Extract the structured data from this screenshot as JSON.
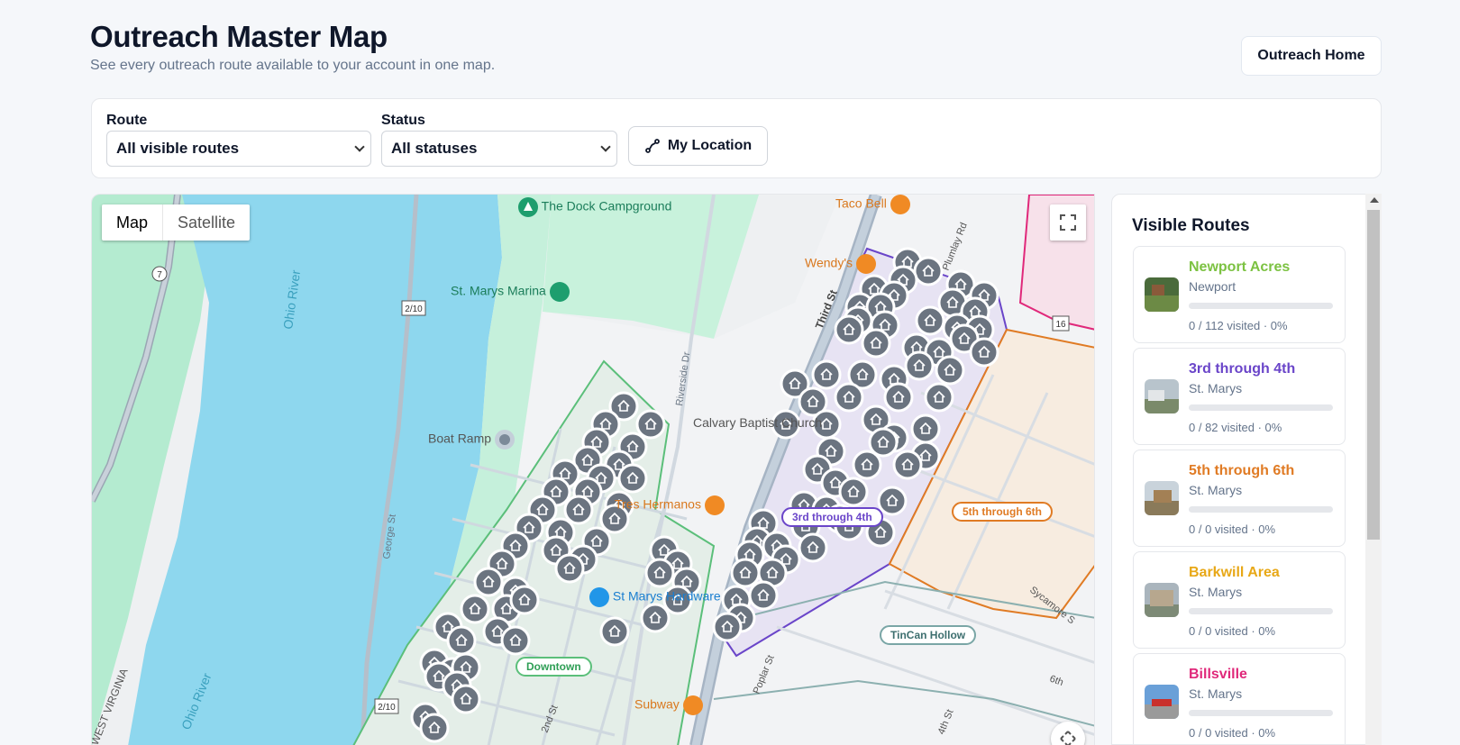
{
  "header": {
    "title": "Outreach Master Map",
    "subtitle": "See every outreach route available to your account in one map.",
    "home_button": "Outreach Home"
  },
  "filters": {
    "route_label": "Route",
    "route_value": "All visible routes",
    "status_label": "Status",
    "status_value": "All statuses",
    "location_button": "My Location"
  },
  "map": {
    "type_controls": [
      "Map",
      "Satellite"
    ],
    "selected_type": "Map",
    "pois": {
      "campground": "The Dock Campground",
      "marina": "St. Marys Marina",
      "boat_ramp": "Boat Ramp",
      "taco_bell": "Taco Bell",
      "wendys": "Wendy's",
      "church": "Calvary Baptist Church",
      "hermanos": "Tres Hermanos",
      "hardware": "St Marys Hardware",
      "subway": "Subway"
    },
    "road_labels": {
      "ohio_river_1": "Ohio River",
      "ohio_river_2": "Ohio River",
      "west_virginia": "WEST VIRGINIA",
      "riverside": "Riverside Dr",
      "george": "George St",
      "third": "Third St",
      "pumlay": "Plumlay Rd",
      "poplar": "Poplar St",
      "second": "2nd St",
      "fourth": "4th St",
      "sixth": "6th",
      "sycamore": "Sycamore S",
      "rt7": "7",
      "rt210a": "2/10",
      "rt210b": "2/10",
      "rt16": "16"
    },
    "route_labels": {
      "third_fourth": "3rd through 4th",
      "fifth_sixth": "5th through 6th",
      "tincan": "TinCan Hollow",
      "downtown": "Downtown"
    }
  },
  "sidebar": {
    "title": "Visible Routes",
    "routes": [
      {
        "name": "Newport Acres",
        "area": "Newport",
        "visited": 0,
        "total": 112,
        "stat": "0 / 112 visited · 0%",
        "color": "#7cc242"
      },
      {
        "name": "3rd through 4th",
        "area": "St. Marys",
        "visited": 0,
        "total": 82,
        "stat": "0 / 82 visited · 0%",
        "color": "#6a45c9"
      },
      {
        "name": "5th through 6th",
        "area": "St. Marys",
        "visited": 0,
        "total": 0,
        "stat": "0 / 0 visited · 0%",
        "color": "#e07b24"
      },
      {
        "name": "Barkwill Area",
        "area": "St. Marys",
        "visited": 0,
        "total": 0,
        "stat": "0 / 0 visited · 0%",
        "color": "#e8a817"
      },
      {
        "name": "Billsville",
        "area": "St. Marys",
        "visited": 0,
        "total": 0,
        "stat": "0 / 0 visited · 0%",
        "color": "#e0287a"
      }
    ]
  }
}
